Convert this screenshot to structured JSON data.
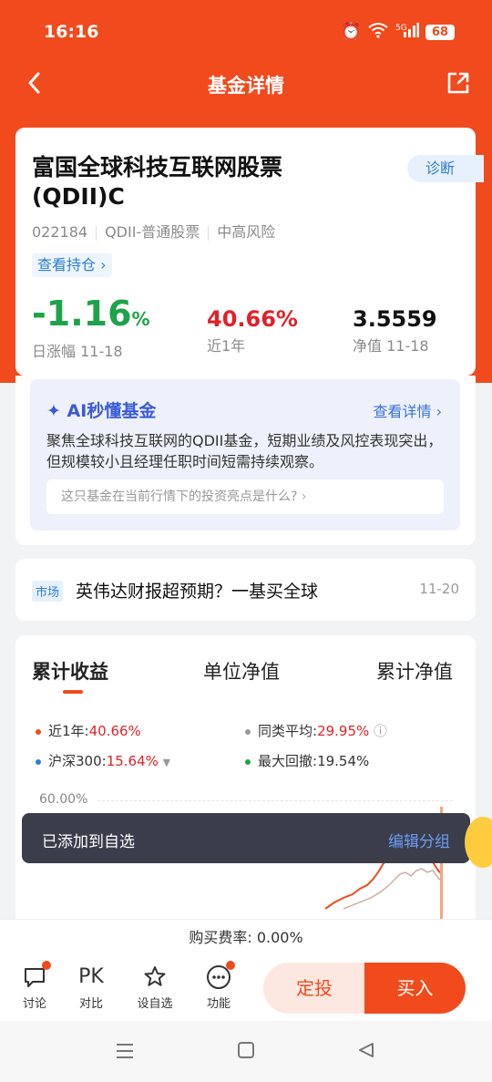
{
  "status": {
    "time": "16:16",
    "battery": "68",
    "network": "5G"
  },
  "topbar": {
    "title": "基金详情"
  },
  "fund": {
    "name": "富国全球科技互联网股票(QDII)C",
    "diagnose": "诊断",
    "code": "022184",
    "type": "QDII-普通股票",
    "risk": "中高风险",
    "holdings": "查看持仓",
    "daily_change": "-1.16",
    "daily_change_unit": "%",
    "daily_label": "日涨幅 11-18",
    "year_return": "40.66%",
    "year_label": "近1年",
    "nav": "3.5559",
    "nav_label": "净值 11-18"
  },
  "ai": {
    "title": "AI秒懂基金",
    "more": "查看详情",
    "desc": "聚焦全球科技互联网的QDII基金，短期业绩及风控表现突出，但规模较小且经理任职时间短需持续观察。",
    "question": "这只基金在当前行情下的投资亮点是什么?"
  },
  "news": {
    "tag": "市场",
    "text": "英伟达财报超预期？一基买全球",
    "date": "11-20"
  },
  "chart": {
    "tabs": [
      "累计收益",
      "单位净值",
      "累计净值"
    ],
    "legend": [
      {
        "label": "近1年:",
        "value": "40.66%",
        "color": "#f04a1d"
      },
      {
        "label": "同类平均:",
        "value": "29.95%",
        "color": "#999999"
      },
      {
        "label": "沪深300:",
        "value": "15.64%",
        "color": "#2e7ed8"
      },
      {
        "label": "最大回撤:",
        "value": "19.54%",
        "color": "#1ea34a"
      }
    ],
    "ytick": "60.00%"
  },
  "toast": {
    "message": "已添加到自选",
    "action": "编辑分组"
  },
  "footer": {
    "fee": "购买费率: 0.00%",
    "buttons": [
      "讨论",
      "对比",
      "设自选",
      "功能"
    ],
    "pk": "PK",
    "fixed": "定投",
    "buy": "买入"
  }
}
